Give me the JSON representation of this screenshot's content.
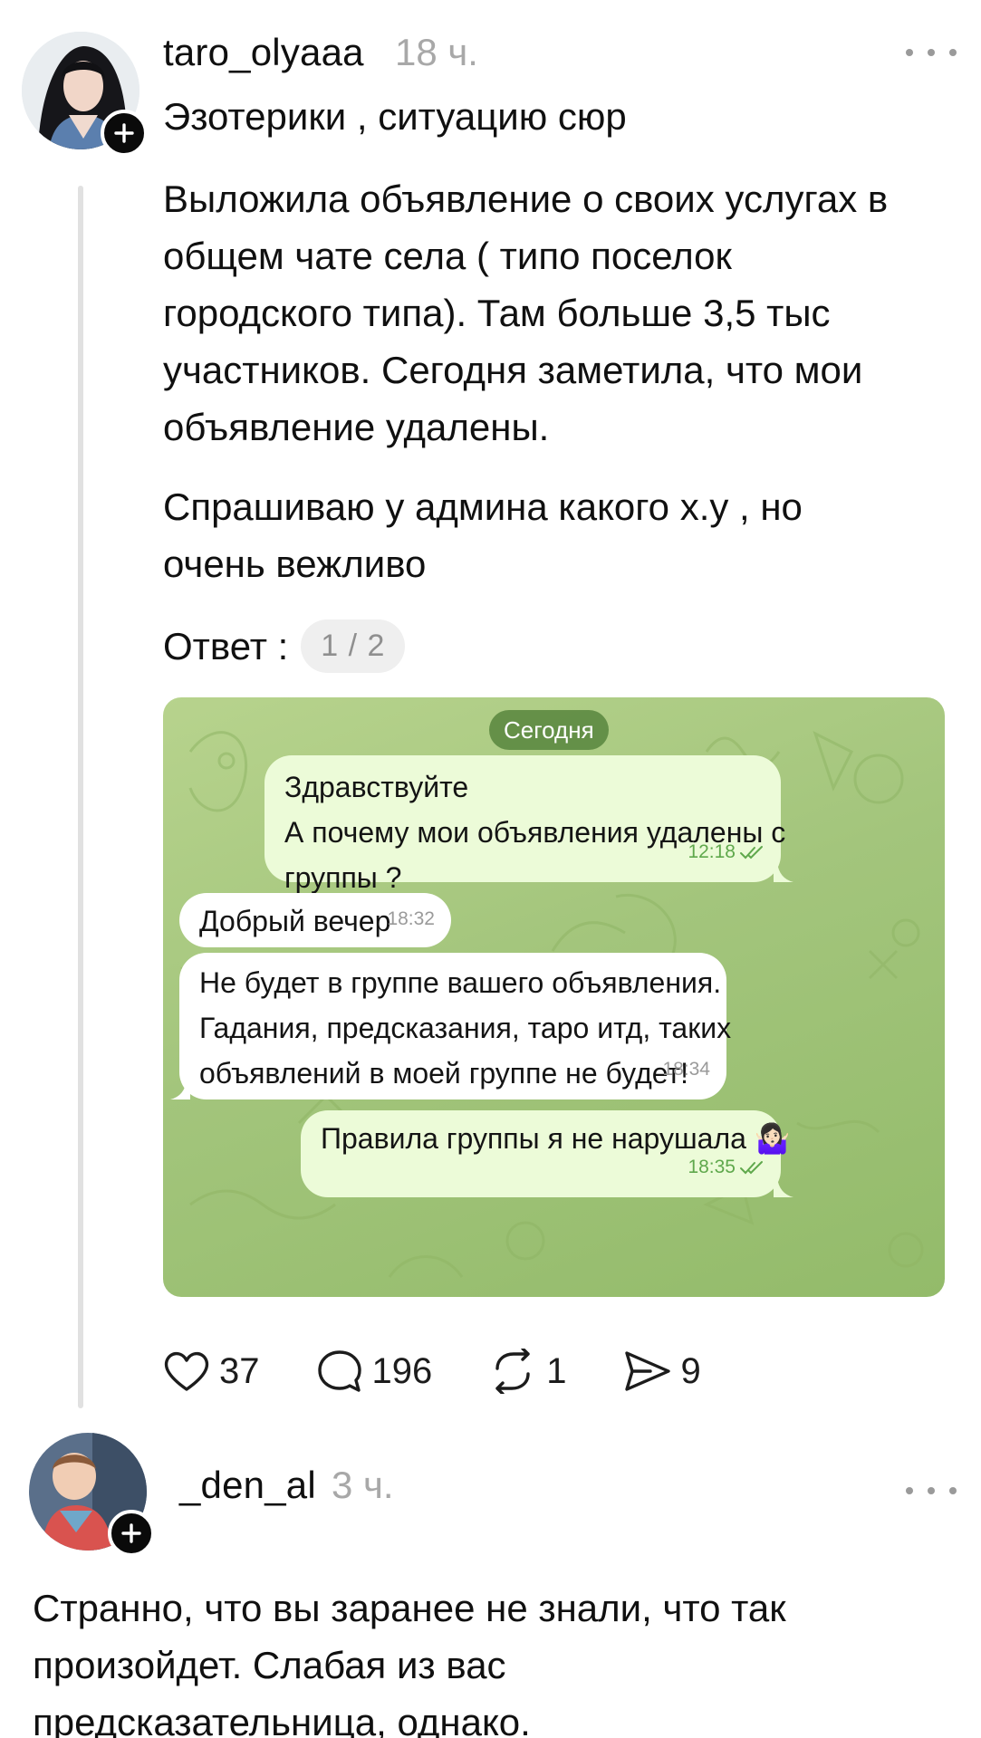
{
  "post": {
    "username": "taro_olyaaa",
    "time": "18 ч.",
    "subtitle": "Эзотерики , ситуацию сюр",
    "paragraph1_lines": [
      "Выложила объявление о своих услугах в",
      "общем чате села ( типо поселок",
      "городского типа). Там больше 3,5 тыс",
      "участников. Сегодня заметила, что мои",
      "объявление удалены."
    ],
    "paragraph2_lines": [
      "Спрашиваю у админа какого х.у , но",
      "очень вежливо"
    ],
    "answer_label": "Ответ :",
    "page_indicator": "1 / 2",
    "actions": {
      "likes": "37",
      "comments": "196",
      "reposts": "1",
      "shares": "9"
    }
  },
  "chat": {
    "date_label": "Сегодня",
    "messages": [
      {
        "direction": "out",
        "lines": [
          "Здравствуйте",
          "А почему мои объявления удалены с",
          "группы ?"
        ],
        "time": "12:18"
      },
      {
        "direction": "in",
        "lines": [
          "Добрый вечер"
        ],
        "time": "18:32"
      },
      {
        "direction": "in",
        "lines": [
          "Не будет в группе вашего объявления.",
          "Гадания, предсказания, таро итд, таких",
          "объявлений в моей группе не будет!"
        ],
        "time": "18:34"
      },
      {
        "direction": "out",
        "lines": [
          "Правила группы я не нарушала 🤷🏻‍♀️"
        ],
        "time": "18:35"
      }
    ],
    "background_color": "#a8c981"
  },
  "reply": {
    "username": "_den_al",
    "time": "3 ч.",
    "text_lines": [
      "Странно, что вы заранее не знали, что так",
      "произойдет. Слабая из вас",
      "предсказательница, однако."
    ]
  },
  "icons": {
    "more": "more-horizontal-icon",
    "follow": "plus-icon",
    "like": "heart-icon",
    "comment": "comment-bubble-icon",
    "repost": "repost-icon",
    "share": "send-icon",
    "read": "double-check-icon"
  }
}
